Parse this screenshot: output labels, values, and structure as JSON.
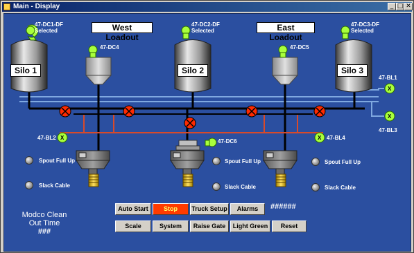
{
  "window": {
    "title": "Main - Display",
    "controls": [
      "_",
      "□",
      "✕"
    ]
  },
  "headers": {
    "west": "West Loadout",
    "east": "East Loadout"
  },
  "silos": [
    "Silo 1",
    "Silo 2",
    "Silo 3"
  ],
  "fans": {
    "dc1": "47-DC1-DF",
    "dc1_status": "Selected",
    "dc2": "47-DC2-DF",
    "dc2_status": "Selected",
    "dc3": "47-DC3-DF",
    "dc3_status": "Selected",
    "dc4": "47-DC4",
    "dc5": "47-DC5",
    "dc6": "47-DC6"
  },
  "blowers": {
    "bl1": "47-BL1",
    "bl2": "47-BL2",
    "bl3": "47-BL3",
    "bl4": "47-BL4",
    "symbol": "X"
  },
  "sensors": {
    "spout_full_up": "Spout Full Up",
    "slack_cable": "Slack Cable"
  },
  "buttons": {
    "auto_start": "Auto Start",
    "stop": "Stop",
    "truck_setup": "Truck Setup",
    "alarms": "Alarms",
    "scale": "Scale",
    "system": "System",
    "raise_gate": "Raise Gate",
    "light_green": "Light Green",
    "reset": "Reset"
  },
  "readout": "######",
  "modco": {
    "line1": "Modco Clean",
    "line2": "Out Time",
    "value": "###"
  },
  "colors": {
    "background": "#2b4fa0",
    "pipe": "#000000",
    "duct": "#7fa8e0",
    "fan": "#a8ff3c",
    "stop_button": "#ff3b00",
    "valve": "#ff2a00"
  }
}
